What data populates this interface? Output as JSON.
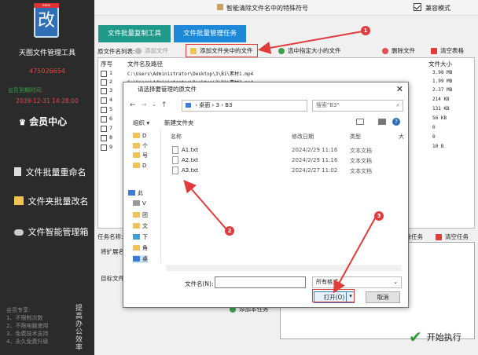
{
  "sidebar": {
    "logo_char": "改",
    "logo_tag": "ZIEN",
    "app_name": "天图文件管理工具",
    "qq": "475026654",
    "expire_label": "会员到期时间:",
    "expire_date": "2039-12-31 14:28:00",
    "vip_center": "会员中心",
    "nav": [
      {
        "label": "文件批量重命名"
      },
      {
        "label": "文件夹批量改名"
      },
      {
        "label": "文件智能管理箱"
      }
    ],
    "vip_benefits": [
      "会员专享:",
      "1、不限制次数",
      "2、不限电脑使用",
      "3、免费技术支持",
      "4、永久免费升级"
    ],
    "slogan": "提高办公效率"
  },
  "topbar": {
    "title": "智能清除文件名中的特殊符号",
    "compat_label": "兼容模式",
    "compat_checked": true
  },
  "tabs": [
    {
      "label": "文件批量复制工具",
      "color": "#1f9a8a"
    },
    {
      "label": "文件批量管理任务",
      "color": "#1e88d8"
    }
  ],
  "toolbar": {
    "list_label": "原文件名列表:",
    "add_file": "添加文件",
    "add_folder_files": "添加文件夹中的文件",
    "select_size": "选中指定大小的文件",
    "delete_file": "删除文件",
    "clear_table": "清空表格"
  },
  "grid": {
    "headers": {
      "num": "序号",
      "path": "文件名及路径",
      "size": "文件大小"
    },
    "rows": [
      {
        "num": "1",
        "path": "C:\\Users\\Administrator\\Desktop\\3\\B1\\素材1.mp4",
        "size": "3.98 MB"
      },
      {
        "num": "2",
        "path": "C:\\Users\\Administrator\\Desktop\\3\\B1\\素材2.mp4",
        "size": "1.99 MB"
      },
      {
        "num": "3",
        "path": "",
        "size": "2.37 MB"
      },
      {
        "num": "4",
        "path": "",
        "size": "214 KB"
      },
      {
        "num": "5",
        "path": "",
        "size": "131 KB"
      },
      {
        "num": "6",
        "path": "",
        "size": "56 KB"
      },
      {
        "num": "7",
        "path": "",
        "size": "0"
      },
      {
        "num": "8",
        "path": "",
        "size": "0"
      },
      {
        "num": "9",
        "path": "",
        "size": "10 B"
      }
    ]
  },
  "lower": {
    "task_label": "任务名称:",
    "ext_label": "将扩展名",
    "target_label": "目标文件",
    "delete_task": "删除任务",
    "clear_task": "清空任务",
    "add_task": "添加本任务",
    "start": "开始执行"
  },
  "dialog": {
    "title": "请选择要管理的原文件",
    "breadcrumb": [
      "桌面",
      "3",
      "B3"
    ],
    "search_placeholder": "搜索\"B3\"",
    "organize": "组织 ▾",
    "new_folder": "新建文件夹",
    "tree": [
      "D",
      "个",
      "号",
      "D",
      "此",
      "V",
      "团",
      "文",
      "下",
      "角",
      "桌",
      "C",
      "新",
      "D"
    ],
    "col_name": "名称",
    "col_date": "修改日期",
    "col_type": "类型",
    "col_size": "大",
    "files": [
      {
        "name": "A1.txt",
        "date": "2024/2/29 11:16",
        "type": "文本文档"
      },
      {
        "name": "A2.txt",
        "date": "2024/2/29 11:16",
        "type": "文本文档"
      },
      {
        "name": "A3.txt",
        "date": "2024/2/27 11:02",
        "type": "文本文档"
      }
    ],
    "filename_label": "文件名(N):",
    "filetype": "所有格式",
    "open": "打开(O)",
    "cancel": "取消"
  },
  "callouts": [
    "1",
    "2",
    "3"
  ],
  "colors": {
    "accent_red": "#e03c3c",
    "sidebar_bg": "#2b2b2b"
  }
}
